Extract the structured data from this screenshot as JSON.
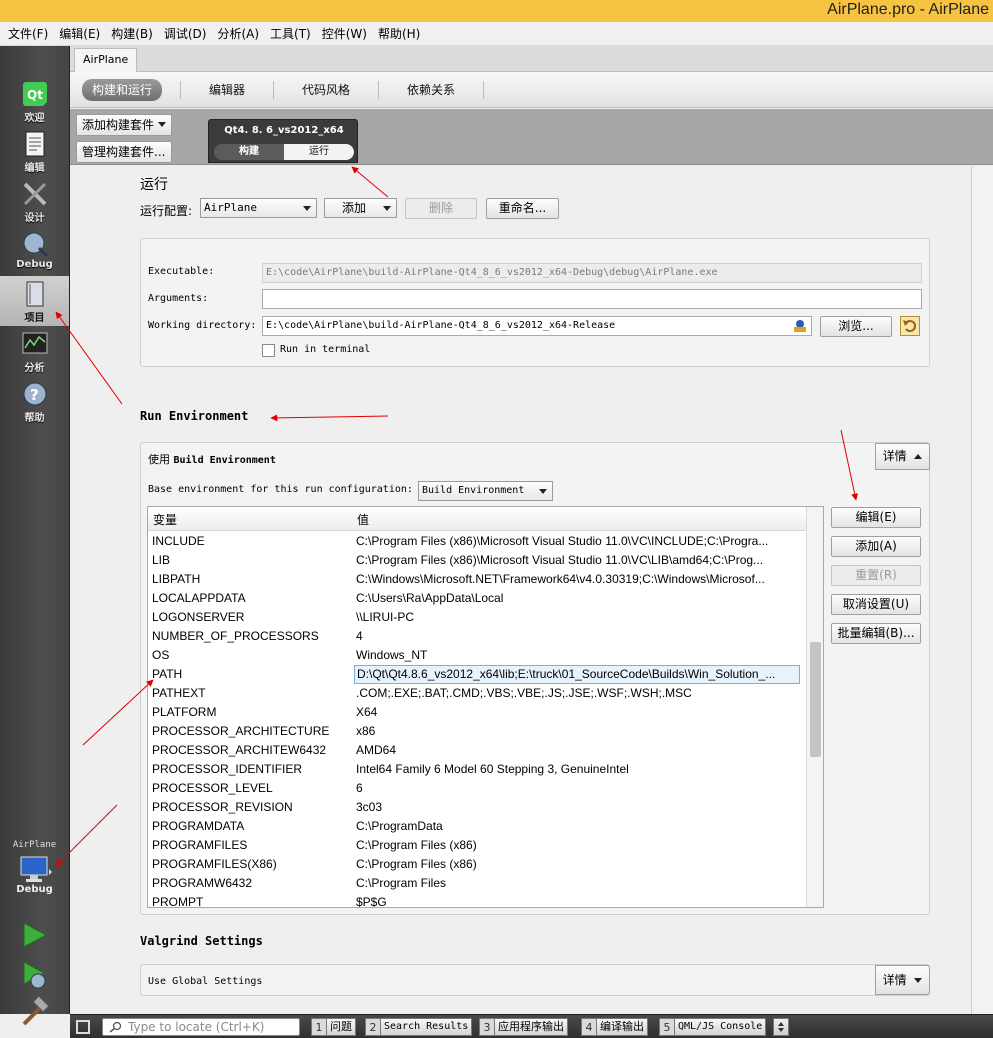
{
  "window": {
    "title": "AirPlane.pro - AirPlane"
  },
  "menu": [
    "文件(F)",
    "编辑(E)",
    "构建(B)",
    "调试(D)",
    "分析(A)",
    "工具(T)",
    "控件(W)",
    "帮助(H)"
  ],
  "modes": {
    "welcome": "欢迎",
    "edit": "编辑",
    "design": "设计",
    "debug": "Debug",
    "projects": "项目",
    "analyze": "分析",
    "help": "帮助"
  },
  "kit_selector": {
    "project": "AirPlane",
    "config": "Debug"
  },
  "project_tab": "AirPlane",
  "subtabs": [
    "构建和运行",
    "编辑器",
    "代码风格",
    "依赖关系"
  ],
  "kit_buttons": {
    "add_kit": "添加构建套件",
    "manage_kits": "管理构建套件..."
  },
  "kit_panel": {
    "name": "Qt4. 8. 6_vs2012_x64",
    "build": "构建",
    "run": "运行"
  },
  "run": {
    "heading": "运行",
    "config_label": "运行配置:",
    "config_value": "AirPlane",
    "add": "添加",
    "remove": "删除",
    "rename": "重命名..."
  },
  "run_settings": {
    "executable_label": "Executable:",
    "executable_value": "E:\\code\\AirPlane\\build-AirPlane-Qt4_8_6_vs2012_x64-Debug\\debug\\AirPlane.exe",
    "arguments_label": "Arguments:",
    "arguments_value": "",
    "workdir_label": "Working directory:",
    "workdir_value": "E:\\code\\AirPlane\\build-AirPlane-Qt4_8_6_vs2012_x64-Release",
    "browse": "浏览...",
    "run_in_terminal": "Run in terminal"
  },
  "run_env": {
    "heading": "Run Environment",
    "use_prefix": "使用",
    "use_value": "Build Environment",
    "details": "详情",
    "base_label": "Base environment for this run configuration:",
    "base_value": "Build Environment",
    "col_var": "变量",
    "col_val": "值",
    "rows": [
      {
        "k": "INCLUDE",
        "v": "C:\\Program Files (x86)\\Microsoft Visual Studio 11.0\\VC\\INCLUDE;C:\\Progra..."
      },
      {
        "k": "LIB",
        "v": "C:\\Program Files (x86)\\Microsoft Visual Studio 11.0\\VC\\LIB\\amd64;C:\\Prog..."
      },
      {
        "k": "LIBPATH",
        "v": "C:\\Windows\\Microsoft.NET\\Framework64\\v4.0.30319;C:\\Windows\\Microsof..."
      },
      {
        "k": "LOCALAPPDATA",
        "v": "C:\\Users\\Ra\\AppData\\Local"
      },
      {
        "k": "LOGONSERVER",
        "v": "\\\\LIRUI-PC"
      },
      {
        "k": "NUMBER_OF_PROCESSORS",
        "v": "4"
      },
      {
        "k": "OS",
        "v": "Windows_NT"
      },
      {
        "k": "PATH",
        "v": "D:\\Qt\\Qt4.8.6_vs2012_x64\\lib;E:\\truck\\01_SourceCode\\Builds\\Win_Solution_..."
      },
      {
        "k": "PATHEXT",
        "v": ".COM;.EXE;.BAT;.CMD;.VBS;.VBE;.JS;.JSE;.WSF;.WSH;.MSC"
      },
      {
        "k": "PLATFORM",
        "v": "X64"
      },
      {
        "k": "PROCESSOR_ARCHITECTURE",
        "v": "x86"
      },
      {
        "k": "PROCESSOR_ARCHITEW6432",
        "v": "AMD64"
      },
      {
        "k": "PROCESSOR_IDENTIFIER",
        "v": "Intel64 Family 6 Model 60 Stepping 3, GenuineIntel"
      },
      {
        "k": "PROCESSOR_LEVEL",
        "v": "6"
      },
      {
        "k": "PROCESSOR_REVISION",
        "v": "3c03"
      },
      {
        "k": "PROGRAMDATA",
        "v": "C:\\ProgramData"
      },
      {
        "k": "PROGRAMFILES",
        "v": "C:\\Program Files (x86)"
      },
      {
        "k": "PROGRAMFILES(X86)",
        "v": "C:\\Program Files (x86)"
      },
      {
        "k": "PROGRAMW6432",
        "v": "C:\\Program Files"
      },
      {
        "k": "PROMPT",
        "v": "$P$G"
      }
    ],
    "selected_row": "PATH",
    "buttons": {
      "edit": "编辑(E)",
      "add": "添加(A)",
      "reset": "重置(R)",
      "unset": "取消设置(U)",
      "batch_edit": "批量编辑(B)..."
    }
  },
  "valgrind": {
    "heading": "Valgrind Settings",
    "value": "Use Global Settings",
    "details": "详情"
  },
  "statusbar": {
    "locator_placeholder": "Type to locate (Ctrl+K)",
    "panes": [
      {
        "n": "1",
        "label": "问题"
      },
      {
        "n": "2",
        "label": "Search Results"
      },
      {
        "n": "3",
        "label": "应用程序输出"
      },
      {
        "n": "4",
        "label": "编译输出"
      },
      {
        "n": "5",
        "label": "QML/JS Console"
      }
    ]
  },
  "colors": {
    "titlebar": "#f7c342",
    "annotation": "#e00000",
    "selection": "#7ab0e0",
    "run_green": "#3fae3f"
  }
}
